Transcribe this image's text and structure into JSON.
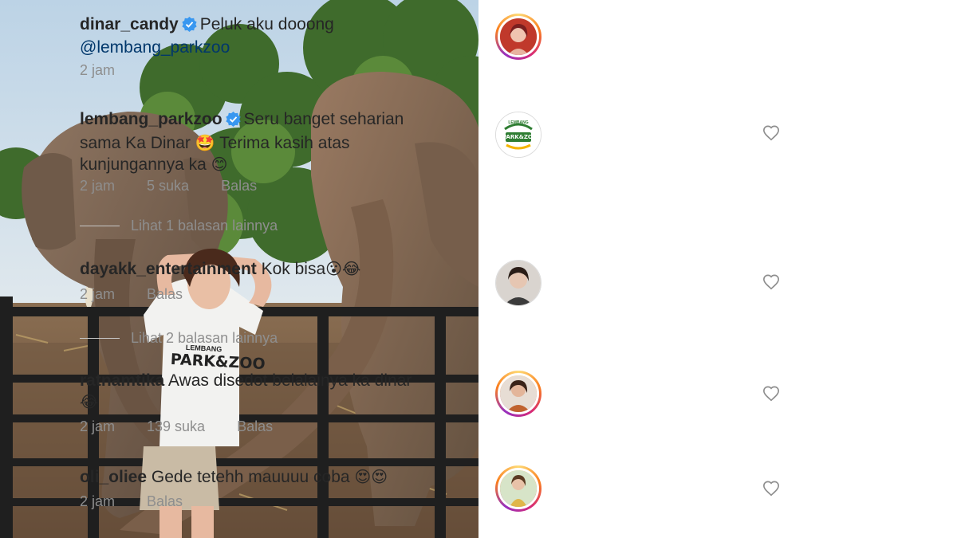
{
  "post": {
    "photo_shirt_text": "PARK&ZOO",
    "photo_shirt_small_text": "LEMBANG"
  },
  "caption": {
    "username": "dinar_candy",
    "text": "Peluk aku dooong",
    "mention": "@lembang_parkzoo",
    "time": "2 jam",
    "avatar_icon": "profile-photo"
  },
  "comments": [
    {
      "username": "lembang_parkzoo",
      "verified": true,
      "text_parts": [
        "Seru banget seharian sama Ka Dinar ",
        "🤩",
        " Terima kasih atas kunjungannya ka ",
        "😊"
      ],
      "time": "2 jam",
      "likes": "5 suka",
      "reply": "Balas",
      "more_replies": "Lihat 1 balasan lainnya",
      "avatar_logo_top": "LEMBANG",
      "avatar_logo_text": "PARK&ZOO"
    },
    {
      "username": "dayakk_entertainment",
      "text_parts": [
        "Kok bisa",
        "😮😂"
      ],
      "time": "2 jam",
      "reply": "Balas",
      "more_replies": "Lihat 2 balasan lainnya"
    },
    {
      "username": "ratnamtika",
      "text_parts": [
        "Awas disedot belalainya ka dinar ",
        "😂"
      ],
      "time": "2 jam",
      "likes": "139 suka",
      "reply": "Balas"
    },
    {
      "username": "oli_oliee",
      "text_parts": [
        "Gede tetehh mauuuu coba ",
        "😍😍"
      ],
      "time": "2 jam",
      "reply": "Balas"
    }
  ],
  "colors": {
    "verified": "#3897f0",
    "mention": "#00376b",
    "meta": "#8e8e8e"
  }
}
